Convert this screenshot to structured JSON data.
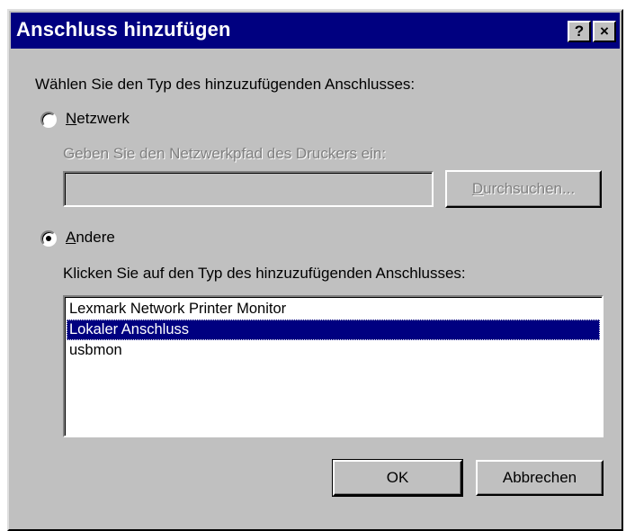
{
  "window": {
    "title": "Anschluss hinzufügen",
    "help_label": "?",
    "close_label": "×"
  },
  "prompt": "Wählen Sie den Typ des hinzuzufügenden Anschlusses:",
  "network": {
    "label": "Netzwerk",
    "selected": false,
    "path_label": "Geben Sie den Netzwerkpfad des Druckers ein:",
    "path_value": "",
    "browse_label": "Durchsuchen..."
  },
  "other": {
    "label": "Andere",
    "selected": true,
    "list_label": "Klicken Sie auf den Typ des hinzuzufügenden Anschlusses:",
    "items": [
      {
        "label": "Lexmark Network Printer Monitor",
        "selected": false
      },
      {
        "label": "Lokaler Anschluss",
        "selected": true
      },
      {
        "label": "usbmon",
        "selected": false
      }
    ]
  },
  "buttons": {
    "ok": "OK",
    "cancel": "Abbrechen"
  },
  "colors": {
    "titlebar": "#000080",
    "face": "#c0c0c0",
    "selection": "#000080"
  }
}
